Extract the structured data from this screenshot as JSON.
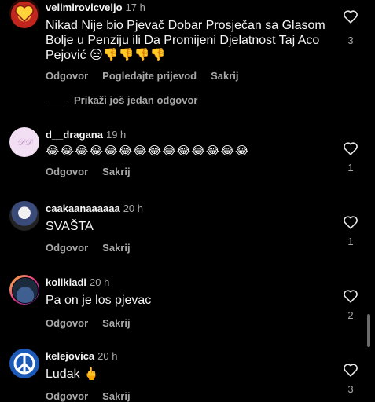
{
  "comments": [
    {
      "username": "velimirovicveljo",
      "time": "17 h",
      "text": "Nikad Nije bio Pjevač Dobar  Prosječan  sa Glasom Bolje   u  Penziju  ili Da Promijeni Djelatnost  Taj  Aco Pejović 😒👎👎👎👎",
      "actions": [
        "Odgovor",
        "Pogledajte prijevod",
        "Sakrij"
      ],
      "likes": "3"
    },
    {
      "username": "d__dragana",
      "time": "19 h",
      "text": "😂😂😂😂😂😂😂😂😂😂😂😂😂😂",
      "actions": [
        "Odgovor",
        "Sakrij"
      ],
      "likes": "1"
    },
    {
      "username": "caakaanaaaaaa",
      "time": "20 h",
      "text": "SVAŠTA",
      "actions": [
        "Odgovor",
        "Sakrij"
      ],
      "likes": "1"
    },
    {
      "username": "kolikiadi",
      "time": "20 h",
      "text": "Pa on je los pjevac",
      "actions": [
        "Odgovor",
        "Sakrij"
      ],
      "likes": "2"
    },
    {
      "username": "kelejovica",
      "time": "20 h",
      "text": "Ludak 🖕",
      "actions": [
        "Odgovor",
        "Sakrij"
      ],
      "likes": "3"
    }
  ],
  "more_replies_label": "Prikaži još jedan odgovor",
  "icons": {
    "like": "heart-outline-icon"
  },
  "colors": {
    "background": "#000000",
    "primary_text": "#f5f5f5",
    "secondary_text": "#a8a8a8"
  }
}
